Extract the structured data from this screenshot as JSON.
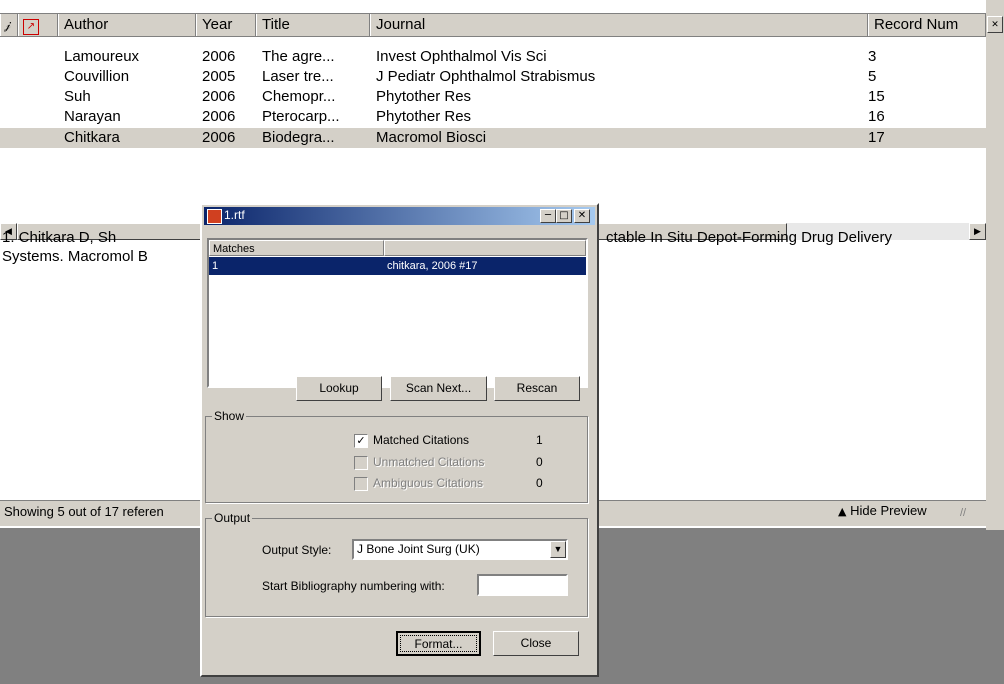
{
  "table": {
    "headers": [
      "Author",
      "Year",
      "Title",
      "Journal",
      "Record Num"
    ],
    "rows": [
      {
        "author": "Lamoureux",
        "year": "2006",
        "title": "The agre...",
        "journal": "Invest Ophthalmol Vis Sci",
        "record": "3"
      },
      {
        "author": "Couvillion",
        "year": "2005",
        "title": "Laser tre...",
        "journal": "J Pediatr Ophthalmol Strabismus",
        "record": "5"
      },
      {
        "author": "Suh",
        "year": "2006",
        "title": "Chemopr...",
        "journal": "Phytother Res",
        "record": "15"
      },
      {
        "author": "Narayan",
        "year": "2006",
        "title": "Pterocarp...",
        "journal": "Phytother Res",
        "record": "16"
      },
      {
        "author": "Chitkara",
        "year": "2006",
        "title": "Biodegra...",
        "journal": "Macromol Biosci",
        "record": "17"
      }
    ]
  },
  "preview": {
    "line1_left": "1.      Chitkara D, Sh",
    "line1_right": "ctable In Situ Depot-Forming Drug Delivery",
    "line2_left": "Systems. Macromol B"
  },
  "status": {
    "showing": "Showing 5 out of 17 referen",
    "hide_preview": "Hide Preview"
  },
  "dialog": {
    "title": "1.rtf",
    "matches_header": "Matches",
    "match_row": {
      "num": "1",
      "text": "chitkara, 2006 #17"
    },
    "buttons": {
      "lookup": "Lookup",
      "scan_next": "Scan Next...",
      "rescan": "Rescan",
      "format": "Format...",
      "close": "Close"
    },
    "show": {
      "label": "Show",
      "items": [
        {
          "label": "Matched Citations",
          "count": "1",
          "checked": true,
          "enabled": true
        },
        {
          "label": "Unmatched Citations",
          "count": "0",
          "checked": false,
          "enabled": false
        },
        {
          "label": "Ambiguous Citations",
          "count": "0",
          "checked": false,
          "enabled": false
        }
      ]
    },
    "output": {
      "label": "Output",
      "style_label": "Output Style:",
      "style_value": "J Bone Joint Surg (UK)",
      "numbering_label": "Start Bibliography numbering with:",
      "numbering_value": ""
    }
  }
}
